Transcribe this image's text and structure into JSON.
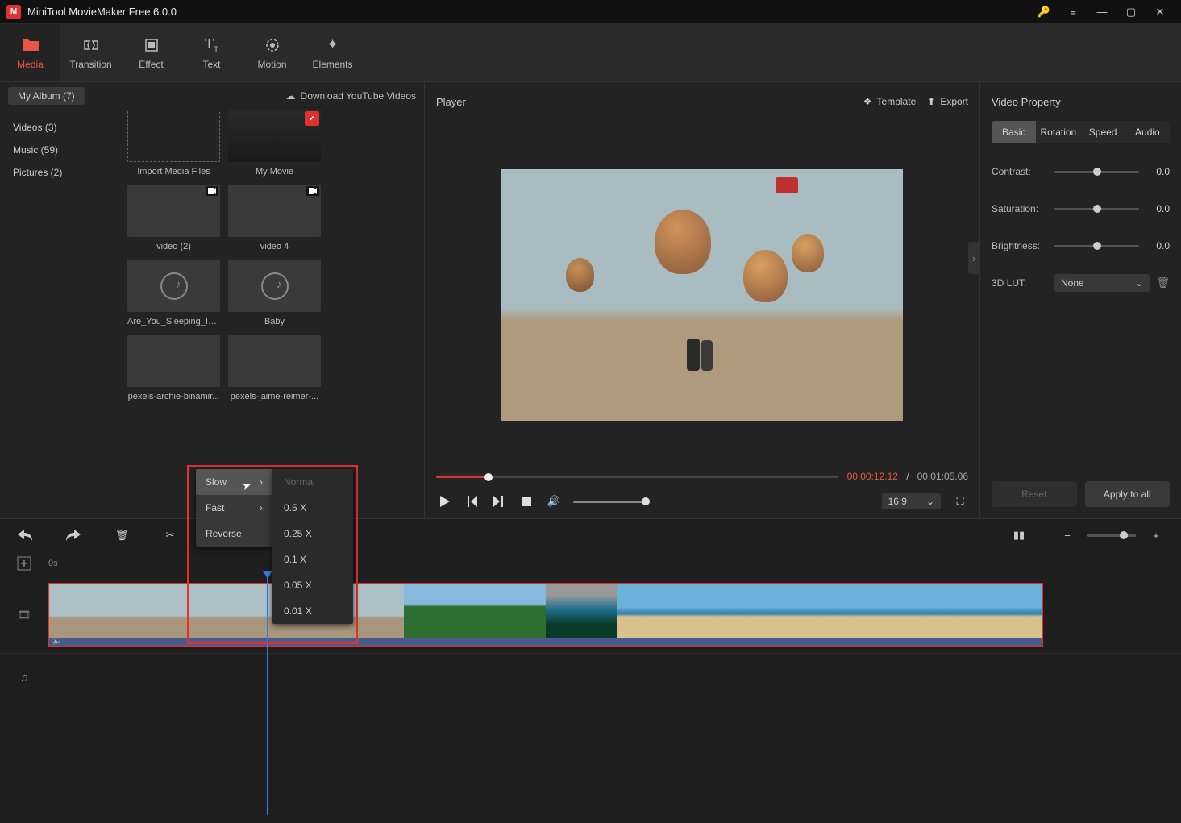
{
  "app": {
    "title": "MiniTool MovieMaker Free 6.0.0"
  },
  "nav": {
    "items": [
      {
        "label": "Media",
        "active": true
      },
      {
        "label": "Transition"
      },
      {
        "label": "Effect"
      },
      {
        "label": "Text"
      },
      {
        "label": "Motion"
      },
      {
        "label": "Elements"
      }
    ]
  },
  "media": {
    "album_label": "My Album (7)",
    "download_label": "Download YouTube Videos",
    "sidebar": [
      {
        "label": "Videos (3)"
      },
      {
        "label": "Music (59)"
      },
      {
        "label": "Pictures (2)"
      }
    ],
    "items": [
      {
        "label": "Import Media Files",
        "kind": "import"
      },
      {
        "label": "My Movie",
        "kind": "video-red"
      },
      {
        "label": "video (2)",
        "kind": "video-sky"
      },
      {
        "label": "video 4",
        "kind": "video-beach"
      },
      {
        "label": "Are_You_Sleeping_In...",
        "kind": "audio"
      },
      {
        "label": "Baby",
        "kind": "audio"
      },
      {
        "label": "pexels-archie-binamir...",
        "kind": "img-green"
      },
      {
        "label": "pexels-jaime-reimer-...",
        "kind": "img-lake"
      }
    ]
  },
  "player": {
    "header": "Player",
    "template_label": "Template",
    "export_label": "Export",
    "time_current": "00:00:12.12",
    "time_separator": "/",
    "time_total": "00:01:05.06",
    "aspect_ratio": "16:9"
  },
  "props": {
    "title": "Video Property",
    "tabs": [
      "Basic",
      "Rotation",
      "Speed",
      "Audio"
    ],
    "active_tab": "Basic",
    "contrast": {
      "label": "Contrast:",
      "value": "0.0"
    },
    "saturation": {
      "label": "Saturation:",
      "value": "0.0"
    },
    "brightness": {
      "label": "Brightness:",
      "value": "0.0"
    },
    "lut": {
      "label": "3D LUT:",
      "value": "None"
    },
    "reset": "Reset",
    "apply": "Apply to all"
  },
  "timeline": {
    "ruler_start": "0s"
  },
  "speed_menu": {
    "items": [
      {
        "label": "Slow",
        "arrow": true,
        "hover": true
      },
      {
        "label": "Fast",
        "arrow": true
      },
      {
        "label": "Reverse"
      }
    ],
    "sub": [
      {
        "label": "Normal",
        "dim": true
      },
      {
        "label": "0.5 X"
      },
      {
        "label": "0.25 X"
      },
      {
        "label": "0.1 X"
      },
      {
        "label": "0.05 X"
      },
      {
        "label": "0.01 X"
      }
    ]
  }
}
